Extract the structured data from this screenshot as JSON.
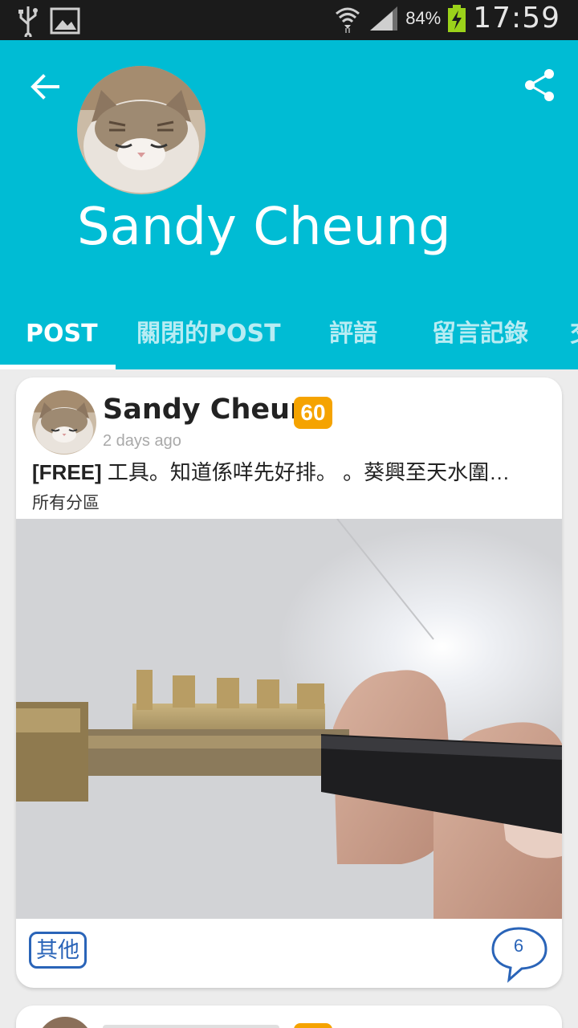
{
  "status_bar": {
    "icons": [
      "usb-icon",
      "image-icon",
      "wifi-icon",
      "signal-icon",
      "battery-charging-icon"
    ],
    "battery": "84%",
    "time": "17:59"
  },
  "header": {
    "name": "Sandy Cheung",
    "background_color": "#00bcd4"
  },
  "tabs": [
    {
      "label": "POST",
      "active": true
    },
    {
      "label": "關閉的POST",
      "active": false
    },
    {
      "label": "評語",
      "active": false
    },
    {
      "label": "留言記錄",
      "active": false
    },
    {
      "label": "交",
      "active": false
    }
  ],
  "post": {
    "author": "Sandy Cheung",
    "level": "60",
    "time": "2 days ago",
    "tag": "[FREE]",
    "title": " 工具。知道係咩先好排。 。葵興至天水圍…",
    "section": "所有分區",
    "category": "其他",
    "comments": "6"
  },
  "colors": {
    "accent": "#00bcd4",
    "badge": "#f5a300",
    "link_blue": "#2a64b8"
  }
}
